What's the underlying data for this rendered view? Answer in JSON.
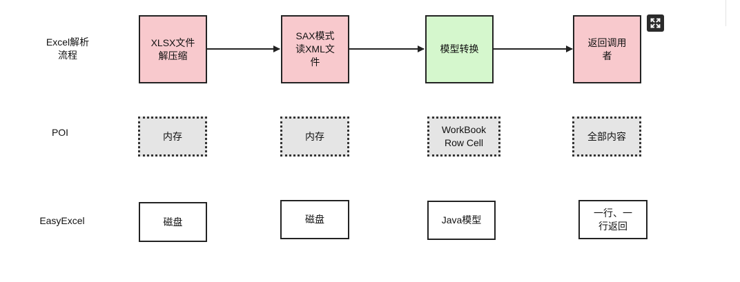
{
  "rows": {
    "flow": "Excel解析\n流程",
    "poi": "POI",
    "easyexcel": "EasyExcel"
  },
  "flow_steps": [
    "XLSX文件\n解压缩",
    "SAX模式\n读XML文\n件",
    "模型转换",
    "返回调用\n者"
  ],
  "poi_cells": [
    "内存",
    "内存",
    "WorkBook\nRow Cell",
    "全部内容"
  ],
  "easyexcel_cells": [
    "磁盘",
    "磁盘",
    "Java模型",
    "一行、一\n行返回"
  ],
  "colors": {
    "step_pink": "#f8c9cd",
    "step_green": "#d5f7cd",
    "poi_fill": "#e5e5e5"
  },
  "icons": {
    "expand": "expand-icon"
  }
}
